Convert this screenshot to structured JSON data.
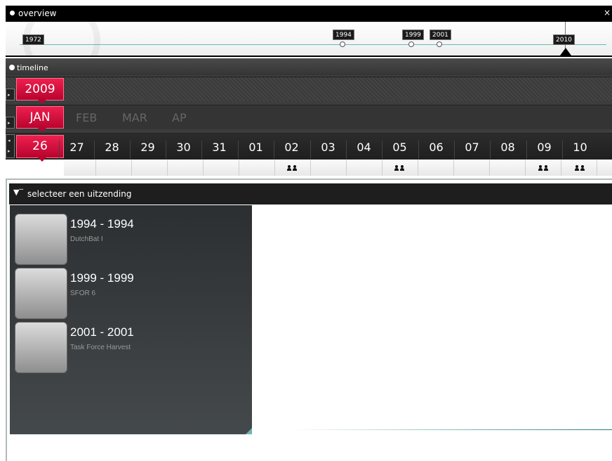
{
  "overview": {
    "title": "overview",
    "close": "×",
    "start_year": "1972",
    "markers": [
      "1994",
      "1999",
      "2001"
    ],
    "current_year": "2010"
  },
  "timeline": {
    "title": "timeline",
    "year": "2009",
    "month": "JAN",
    "months": [
      "FEB",
      "MAR",
      "AP"
    ],
    "day": "26",
    "days": [
      "27",
      "28",
      "29",
      "30",
      "31",
      "01",
      "02",
      "03",
      "04",
      "05",
      "06",
      "07",
      "08",
      "09",
      "10"
    ]
  },
  "selector": {
    "title": "selecteer een uitzending",
    "items": [
      {
        "title": "1994 - 1994",
        "subtitle": "DutchBat I"
      },
      {
        "title": "1999 - 1999",
        "subtitle": "SFOR 6"
      },
      {
        "title": "2001 - 2001",
        "subtitle": "Task Force Harvest"
      }
    ]
  },
  "colors": {
    "accent": "#d90a3a",
    "teal": "#69b7b5"
  },
  "icons": [
    "overview-dot-icon",
    "timeline-clock-icon",
    "filter-icon",
    "people-icon"
  ]
}
